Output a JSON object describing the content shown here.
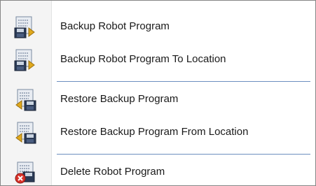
{
  "menu": {
    "items": [
      {
        "label": "Backup Robot Program",
        "icon": "backup-robot-program-icon"
      },
      {
        "label": "Backup Robot Program To Location",
        "icon": "backup-robot-program-to-location-icon"
      },
      {
        "label": "Restore Backup Program",
        "icon": "restore-backup-program-icon"
      },
      {
        "label": "Restore Backup Program From Location",
        "icon": "restore-backup-program-from-location-icon"
      },
      {
        "label": "Delete Robot Program",
        "icon": "delete-robot-program-icon"
      }
    ],
    "colors": {
      "separator": "#6c8ebf",
      "gutter": "#f4f4f4",
      "border": "#868686",
      "icon_page": "#e8ecf2",
      "icon_disk": "#2b3a55",
      "icon_arrow": "#e0a81c",
      "icon_delete": "#d8322a"
    }
  }
}
